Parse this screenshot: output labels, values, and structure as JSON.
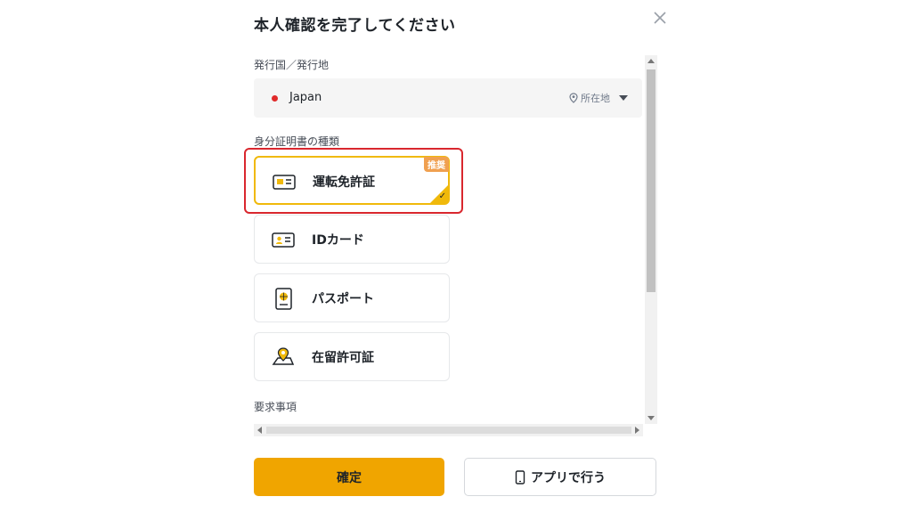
{
  "dialog": {
    "title": "本人確認を完了してください",
    "close_icon": "close-icon"
  },
  "issuing_country": {
    "label": "発行国／発行地",
    "value": "Japan",
    "location_tag": "所在地",
    "flag_color": "#e02a2a"
  },
  "id_type": {
    "label": "身分証明書の種類",
    "options": [
      {
        "label": "運転免許証",
        "icon": "drivers-license-icon",
        "badge": "推奨",
        "selected": true
      },
      {
        "label": "IDカード",
        "icon": "id-card-icon",
        "selected": false
      },
      {
        "label": "パスポート",
        "icon": "passport-icon",
        "selected": false
      },
      {
        "label": "在留許可証",
        "icon": "residence-permit-icon",
        "selected": false
      }
    ]
  },
  "requirements": {
    "label": "要求事項"
  },
  "footer": {
    "confirm_label": "確定",
    "app_label": "アプリで行う"
  },
  "colors": {
    "accent": "#f0a500",
    "highlight": "#d9272e"
  }
}
